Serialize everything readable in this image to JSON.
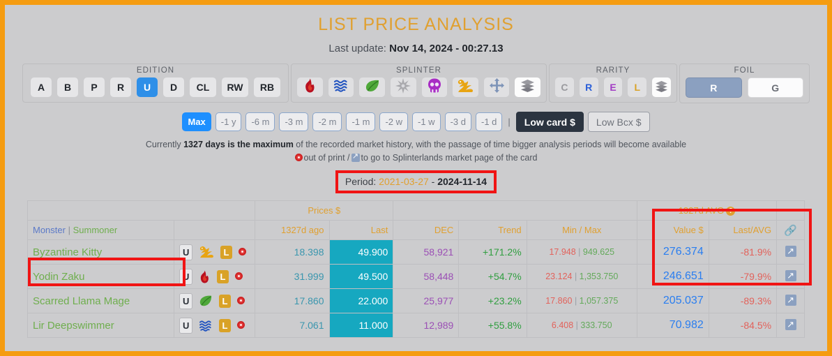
{
  "header": {
    "title": "LIST PRICE ANALYSIS",
    "last_update_label": "Last update:",
    "last_update_value": "Nov 14, 2024 - 00:27.13"
  },
  "filters": {
    "edition": {
      "title": "EDITION",
      "options": [
        {
          "label": "A",
          "active": false
        },
        {
          "label": "B",
          "active": false
        },
        {
          "label": "P",
          "active": false
        },
        {
          "label": "R",
          "active": false
        },
        {
          "label": "U",
          "active": true
        },
        {
          "label": "D",
          "active": false
        },
        {
          "label": "CL",
          "active": false
        },
        {
          "label": "RW",
          "active": false
        },
        {
          "label": "RB",
          "active": false
        }
      ]
    },
    "splinter": {
      "title": "SPLINTER",
      "options": [
        {
          "icon": "fire-icon",
          "name": "fire",
          "active": false
        },
        {
          "icon": "water-icon",
          "name": "water",
          "active": false
        },
        {
          "icon": "earth-icon",
          "name": "earth",
          "active": false
        },
        {
          "icon": "life-icon",
          "name": "life",
          "active": false
        },
        {
          "icon": "death-icon",
          "name": "death",
          "active": false
        },
        {
          "icon": "dragon-icon",
          "name": "dragon",
          "active": false
        },
        {
          "icon": "neutral-icon",
          "name": "neutral",
          "active": false
        },
        {
          "icon": "all-splinters-icon",
          "name": "all",
          "active": true
        }
      ]
    },
    "rarity": {
      "title": "RARITY",
      "options": [
        {
          "label": "C",
          "class": "rar-c",
          "active": false
        },
        {
          "label": "R",
          "class": "rar-r",
          "active": false
        },
        {
          "label": "E",
          "class": "rar-e",
          "active": false
        },
        {
          "label": "L",
          "class": "rar-l",
          "active": false
        },
        {
          "label": "",
          "icon": "all-rarities-icon",
          "active": true
        }
      ]
    },
    "foil": {
      "title": "FOIL",
      "options": [
        {
          "label": "R",
          "active": true
        },
        {
          "label": "G",
          "active": false
        }
      ]
    }
  },
  "period_buttons": [
    {
      "label": "Max",
      "active": true
    },
    {
      "label": "-1 y",
      "active": false
    },
    {
      "label": "-6 m",
      "active": false
    },
    {
      "label": "-3 m",
      "active": false
    },
    {
      "label": "-2 m",
      "active": false
    },
    {
      "label": "-1 m",
      "active": false
    },
    {
      "label": "-2 w",
      "active": false
    },
    {
      "label": "-1 w",
      "active": false
    },
    {
      "label": "-3 d",
      "active": false
    },
    {
      "label": "-1 d",
      "active": false
    }
  ],
  "low_buttons": {
    "low_card": "Low card $",
    "low_bcx": "Low Bcx $"
  },
  "info": {
    "line1_pre": "Currently ",
    "line1_bold": "1327 days is the maximum",
    "line1_post": " of the recorded market history, with the passage of time bigger analysis periods will become available",
    "line2_a": "out of print /",
    "line2_b": "to go to Splinterlands market page of the card"
  },
  "period": {
    "label": "Period:",
    "start": "2021-03-27",
    "dash": "-",
    "end": "2024-11-14"
  },
  "table": {
    "group_headers": {
      "prices": "Prices $",
      "avg": "1327d AVG"
    },
    "columns": {
      "monster": "Monster",
      "pipe": "|",
      "summoner": "Summoner",
      "ago": "1327d ago",
      "last": "Last",
      "dec": "DEC",
      "trend": "Trend",
      "minmax": "Min / Max",
      "value": "Value $",
      "lastavg": "Last/AVG",
      "link": "link-icon"
    },
    "rows": [
      {
        "name": "Byzantine Kitty",
        "edition": "U",
        "splinter": "dragon",
        "rarity": "L",
        "out_of_print": true,
        "ago": "18.398",
        "last": "49.900",
        "dec": "58,921",
        "trend": "+171.2%",
        "min": "17.948",
        "max": "949.625",
        "value": "276.374",
        "last_avg": "-81.9%"
      },
      {
        "name": "Yodin Zaku",
        "edition": "U",
        "splinter": "fire",
        "rarity": "L",
        "out_of_print": true,
        "ago": "31.999",
        "last": "49.500",
        "dec": "58,448",
        "trend": "+54.7%",
        "min": "23.124",
        "max": "1,353.750",
        "value": "246.651",
        "last_avg": "-79.9%"
      },
      {
        "name": "Scarred Llama Mage",
        "edition": "U",
        "splinter": "earth",
        "rarity": "L",
        "out_of_print": true,
        "ago": "17.860",
        "last": "22.000",
        "dec": "25,977",
        "trend": "+23.2%",
        "min": "17.860",
        "max": "1,057.375",
        "value": "205.037",
        "last_avg": "-89.3%"
      },
      {
        "name": "Lir Deepswimmer",
        "edition": "U",
        "splinter": "water",
        "rarity": "L",
        "out_of_print": true,
        "ago": "7.061",
        "last": "11.000",
        "dec": "12,989",
        "trend": "+55.8%",
        "min": "6.408",
        "max": "333.750",
        "value": "70.982",
        "last_avg": "-84.5%"
      }
    ]
  },
  "colors": {
    "page_border": "#f59c11",
    "background": "#ccccce",
    "accent_gold": "#e0a030",
    "highlight_red": "#f01414",
    "active_blue": "#1e8fff",
    "teal": "#16a8c0",
    "value_blue": "#2a7ef0"
  }
}
